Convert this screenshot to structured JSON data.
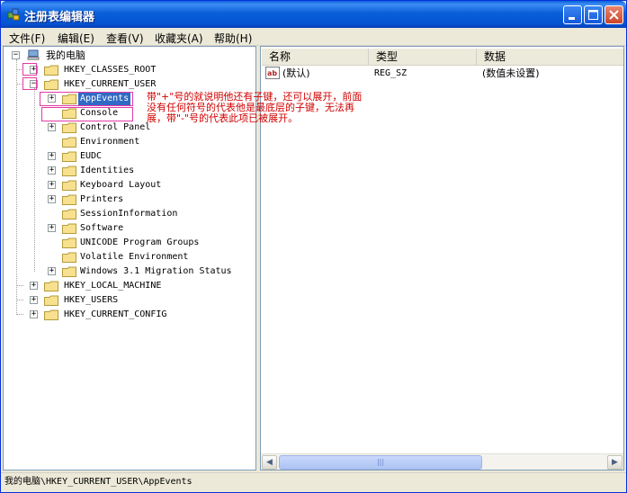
{
  "window": {
    "title": "注册表编辑器"
  },
  "menu": [
    {
      "label": "文件(F)"
    },
    {
      "label": "编辑(E)"
    },
    {
      "label": "查看(V)"
    },
    {
      "label": "收藏夹(A)"
    },
    {
      "label": "帮助(H)"
    }
  ],
  "tree": {
    "root": "我的电脑",
    "hkcr": "HKEY_CLASSES_ROOT",
    "hkcu": "HKEY_CURRENT_USER",
    "children": [
      "AppEvents",
      "Console",
      "Control Panel",
      "Environment",
      "EUDC",
      "Identities",
      "Keyboard Layout",
      "Printers",
      "SessionInformation",
      "Software",
      "UNICODE Program Groups",
      "Volatile Environment",
      "Windows 3.1 Migration Status"
    ],
    "hklm": "HKEY_LOCAL_MACHINE",
    "hku": "HKEY_USERS",
    "hkcc": "HKEY_CURRENT_CONFIG"
  },
  "list": {
    "headers": [
      "名称",
      "类型",
      "数据"
    ],
    "rows": [
      {
        "name": "(默认)",
        "type": "REG_SZ",
        "data": "(数值未设置)"
      }
    ]
  },
  "annotation": {
    "text": "带\"+\"号的就说明他还有子键，还可以展开，前面没有任何符号的代表他是最底层的子键，无法再展，带\"-\"号的代表此项已被展开。"
  },
  "status": {
    "path": "我的电脑\\HKEY_CURRENT_USER\\AppEvents"
  },
  "colors": {
    "annotation": "#d10000",
    "highlight": "#e23aa6",
    "selection": "#316ac5",
    "titlebar": "#0a5fd8"
  }
}
